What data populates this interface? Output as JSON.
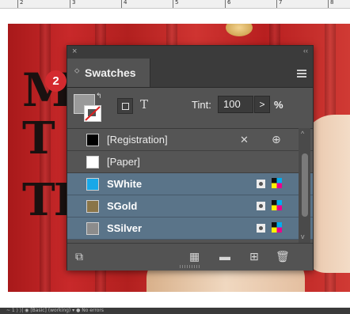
{
  "ruler": {
    "numbers": [
      "2",
      "3",
      "4",
      "5",
      "6",
      "7",
      "8"
    ]
  },
  "artwork": {
    "letters": [
      "M",
      "T",
      "TR"
    ]
  },
  "status_bar": {
    "text": "~ 1 ⟩ ⟩| ◉ [Basic] (working) ▾ ● No errors"
  },
  "step_badge": "2",
  "panel": {
    "close_glyph": "×",
    "collapse_glyph": "‹‹",
    "tab_label": "Swatches",
    "tab_arrows": "⬦",
    "controls": {
      "swap_glyph": "↰",
      "text_button": "T",
      "tint_label": "Tint:",
      "tint_value": "100",
      "tint_arrow": ">",
      "tint_percent": "%"
    },
    "swatches": [
      {
        "name": "[Registration]",
        "color": "#000000",
        "selected": false
      },
      {
        "name": "[Paper]",
        "color": "#ffffff",
        "selected": false
      },
      {
        "name": "SWhite",
        "color": "#18a8e8",
        "selected": true
      },
      {
        "name": "SGold",
        "color": "#8a7548",
        "selected": true
      },
      {
        "name": "SSilver",
        "color": "#8c8c8c",
        "selected": true
      }
    ],
    "registration_icons": {
      "non_editable": "✕",
      "registration": "⊕"
    },
    "scroll": {
      "up": "^",
      "down": "v"
    },
    "footer": {
      "show_options": "⧉",
      "swatch_views": "▦",
      "new_group": "▬",
      "new_swatch": "⊞",
      "delete": "🗑"
    }
  }
}
